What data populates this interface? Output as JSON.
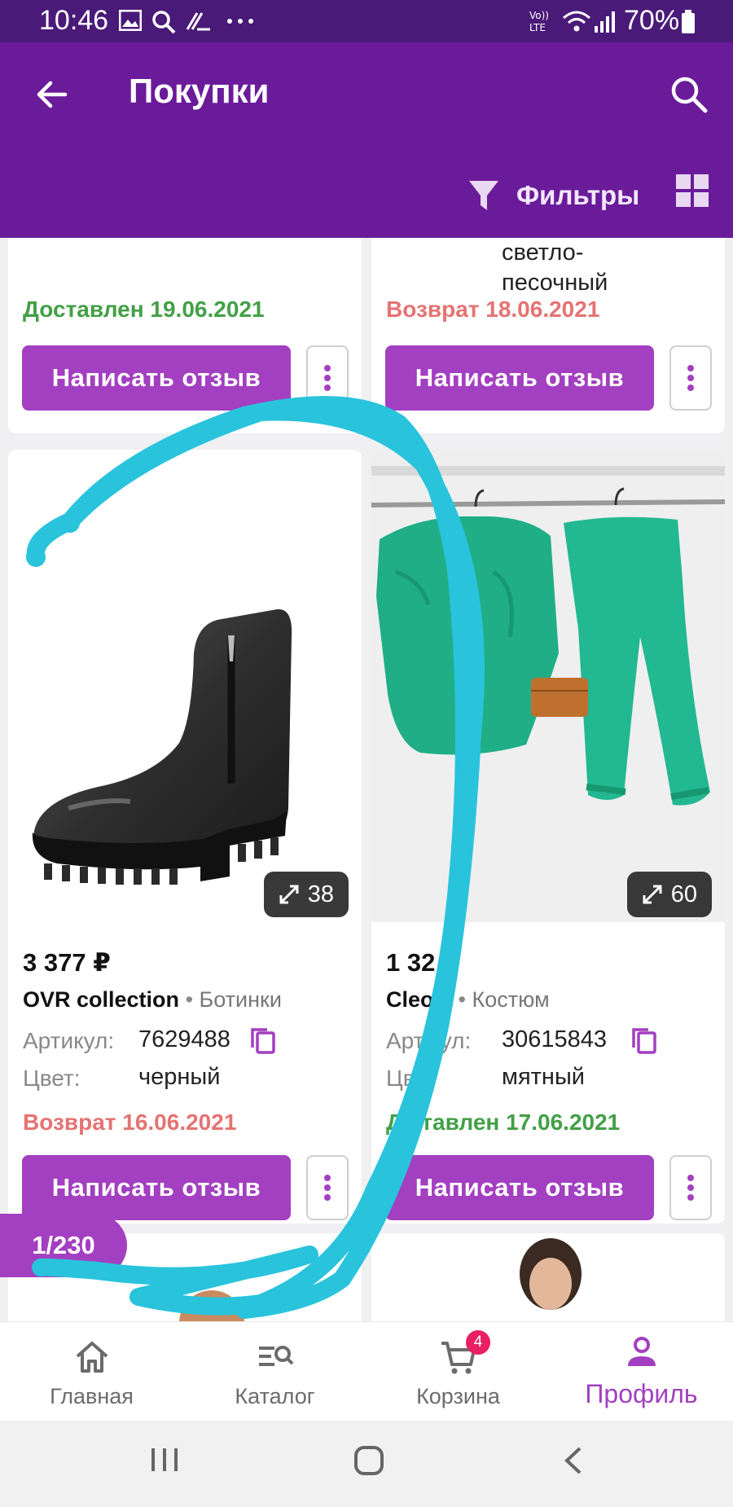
{
  "status_bar": {
    "time": "10:46",
    "battery": "70%",
    "icons": [
      "image-icon",
      "search-icon",
      "app-icon",
      "more-dots-icon",
      "volte-icon",
      "wifi-icon",
      "signal-icon",
      "battery-icon"
    ]
  },
  "header": {
    "title": "Покупки",
    "filters_label": "Фильтры"
  },
  "cards_top": [
    {
      "color_continued": [
        "светло-",
        "песочный"
      ],
      "status": "",
      "review_label": "Написать отзыв"
    }
  ],
  "card_left_top": {
    "status": "Доставлен 19.06.2021",
    "review_label": "Написать отзыв"
  },
  "card_right_top": {
    "color_lines": [
      "светло-",
      "песочный"
    ],
    "status": "Возврат 18.06.2021",
    "review_label": "Написать отзыв"
  },
  "products": [
    {
      "photo_count": "38",
      "price": "3 377 ₽",
      "brand": "OVR collection",
      "separator": "•",
      "category": "Ботинки",
      "article_label": "Артикул:",
      "article": "7629488",
      "color_label": "Цвет:",
      "color": "черный",
      "status": "Возврат 16.06.2021",
      "status_type": "returned",
      "review_label": "Написать отзыв"
    },
    {
      "photo_count": "60",
      "price": "1 32  ₽",
      "brand": "Cleo a",
      "separator": "•",
      "category": "Костюм",
      "article_label": "Арт  кул:",
      "article": "30615843",
      "color_label": "Цв  :",
      "color": "мятный",
      "status": "Д  ставлен 17.06.2021",
      "status_type": "delivered",
      "review_label": "Написать отзыв"
    }
  ],
  "pagination": "1/230",
  "bottom_nav": [
    {
      "label": "Главная",
      "icon": "home-icon"
    },
    {
      "label": "Каталог",
      "icon": "catalog-search-icon"
    },
    {
      "label": "Корзина",
      "icon": "cart-icon",
      "badge": "4"
    },
    {
      "label": "Профиль",
      "icon": "profile-icon",
      "active": true
    }
  ],
  "colors": {
    "status_bar": "#4a1a78",
    "header": "#6a1b9a",
    "accent": "#a33fc1",
    "delivered": "#43a047",
    "returned": "#e57373",
    "scribble": "#29c3dc"
  }
}
